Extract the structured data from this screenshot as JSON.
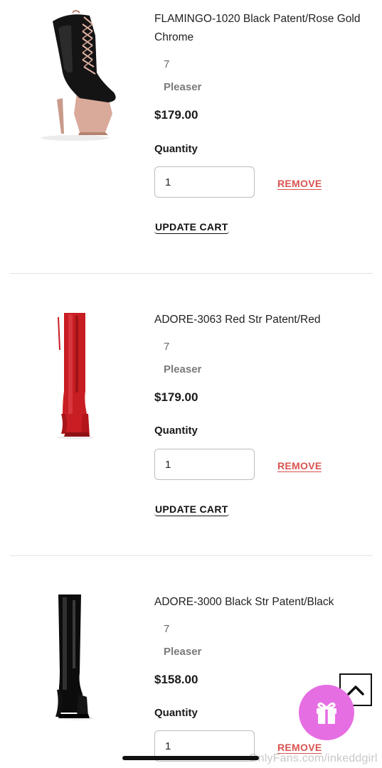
{
  "cart_items": [
    {
      "title": "FLAMINGO-1020 Black Patent/Rose Gold Chrome",
      "size": "7",
      "brand": "Pleaser",
      "price": "$179.00",
      "quantity_label": "Quantity",
      "quantity_value": "1",
      "remove_label": "REMOVE",
      "update_label": "UPDATE CART",
      "image": "ankle-boot-black-rose-gold"
    },
    {
      "title": "ADORE-3063 Red Str Patent/Red",
      "size": "7",
      "brand": "Pleaser",
      "price": "$179.00",
      "quantity_label": "Quantity",
      "quantity_value": "1",
      "remove_label": "REMOVE",
      "update_label": "UPDATE CART",
      "image": "thigh-boot-red"
    },
    {
      "title": "ADORE-3000 Black Str Patent/Black",
      "size": "7",
      "brand": "Pleaser",
      "price": "$158.00",
      "quantity_label": "Quantity",
      "quantity_value": "1",
      "remove_label": "REMOVE",
      "image": "thigh-boot-black"
    }
  ],
  "controls": {
    "scroll_top_icon": "chevron-up-icon",
    "gift_icon": "gift-icon"
  },
  "watermark": "OnlyFans.com/inkeddgirl",
  "colors": {
    "remove": "#d9534f",
    "gift_button": "#e66ee3"
  }
}
